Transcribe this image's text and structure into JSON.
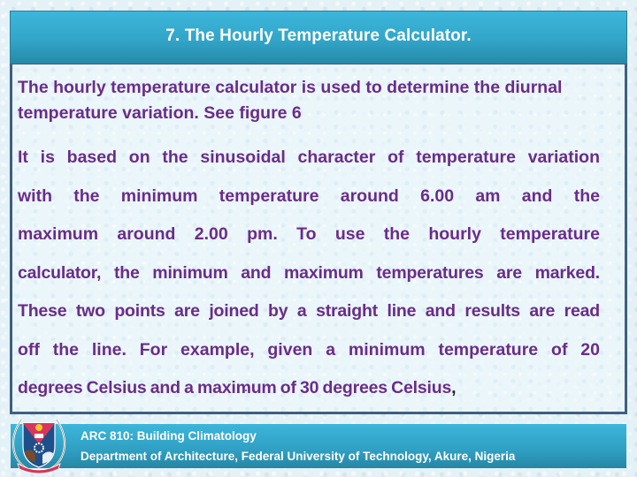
{
  "slide": {
    "title": "7. The Hourly Temperature Calculator.",
    "body": {
      "paragraph_1": "The hourly temperature calculator is used to determine the diurnal temperature variation. See figure 6",
      "paragraph_1_lines": [
        "The hourly temperature calculator is used to determine the diurnal",
        "temperature variation. See figure 6"
      ],
      "paragraph_2_lines": [
        "It is based on the sinusoidal character of temperature variation",
        "with the minimum temperature around 6.00 am and the",
        "maximum around 2.00 pm. To use the hourly temperature",
        "calculator, the minimum and maximum temperatures are marked.",
        "These two points are joined by a straight line and results are read",
        "off the line. For example, given a minimum temperature of 20",
        "degrees Celsius and a maximum of 30 degrees Celsius"
      ],
      "paragraph_2_trailing": ","
    },
    "footer": {
      "course": "ARC 810: Building Climatology",
      "institution": "Department of Architecture, Federal University of Technology, Akure, Nigeria",
      "logo_icon": "university-crest-icon"
    },
    "colors": {
      "title_bar": "#32a5c8",
      "body_text": "#6a2c8a",
      "content_border": "#3f5f80",
      "background": "#e4f2f8",
      "footer_text": "#ffffff"
    }
  }
}
